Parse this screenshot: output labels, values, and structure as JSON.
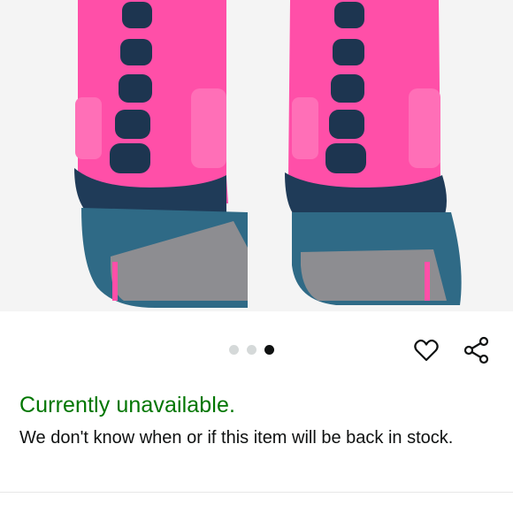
{
  "product": {
    "image_alt": "Pink and navy athletic socks",
    "carousel": {
      "count": 3,
      "active_index": 2
    }
  },
  "actions": {
    "wishlist_icon": "heart-icon",
    "share_icon": "share-icon"
  },
  "availability": {
    "status": "Currently unavailable.",
    "message": "We don't know when or if this item will be back in stock.",
    "status_color": "#007600"
  },
  "colors": {
    "sock_pink": "#ff4fa8",
    "sock_navy": "#1d3550",
    "sock_teal": "#3a6e85",
    "sock_gray": "#8f8f93"
  }
}
